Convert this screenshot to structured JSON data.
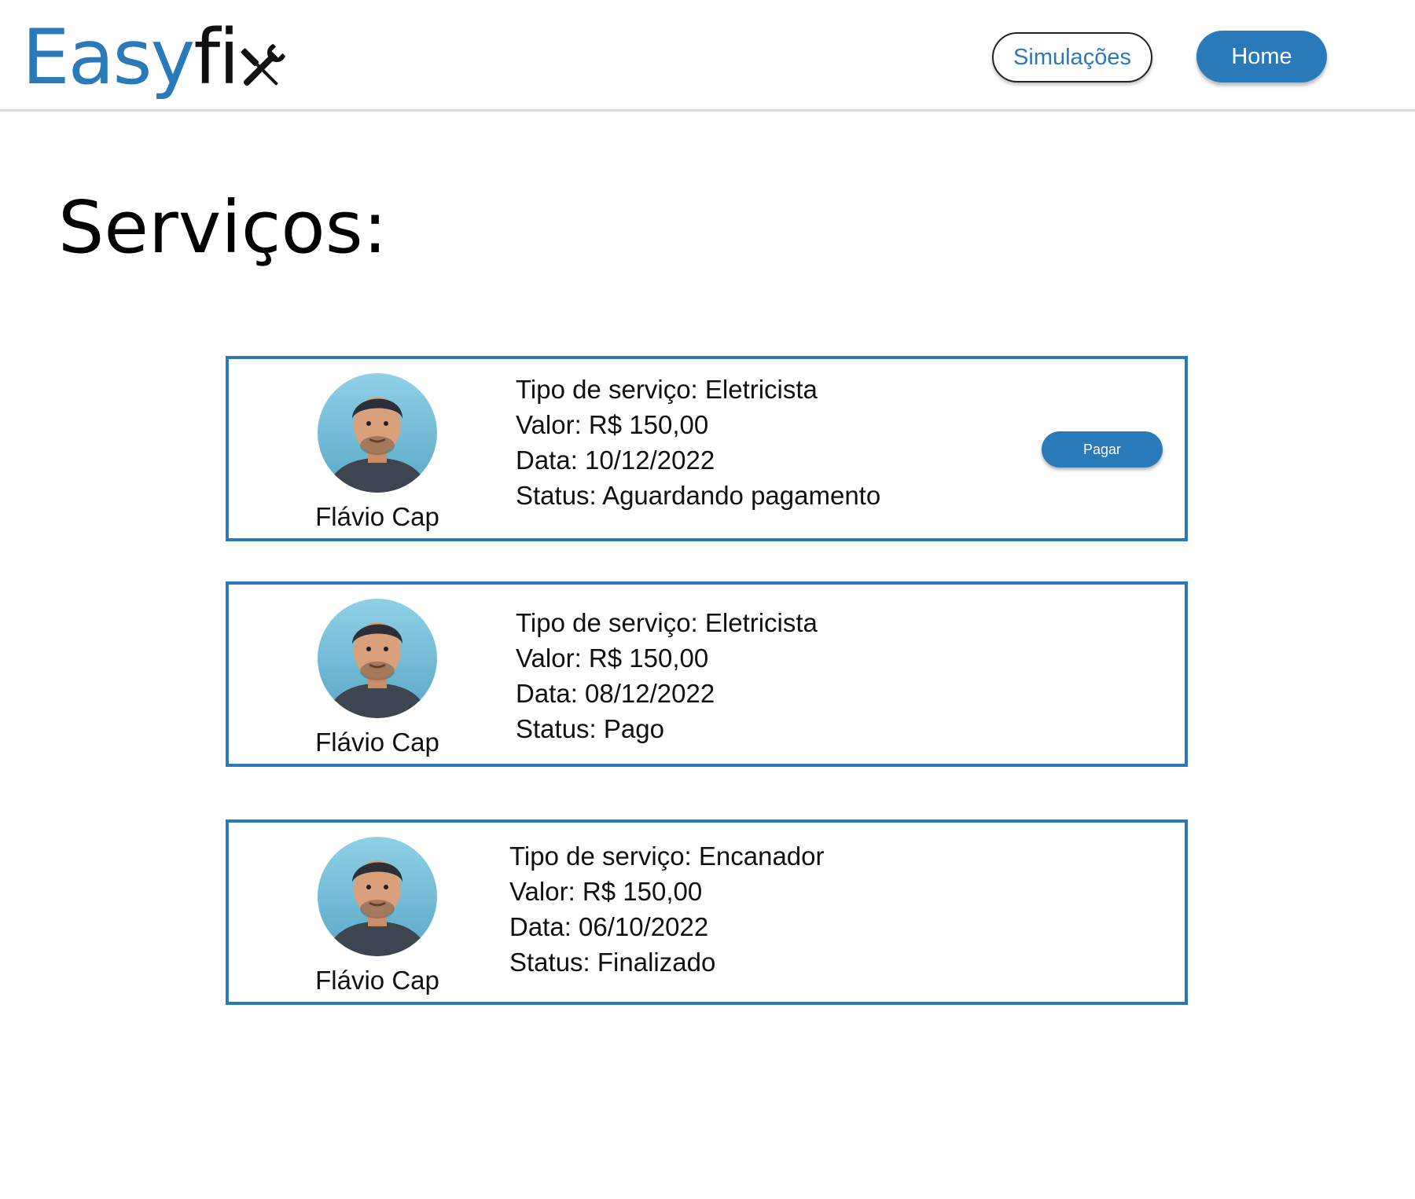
{
  "header": {
    "logo_easy": "Easy",
    "logo_fix": "fi",
    "nav_simulacoes": "Simulações",
    "nav_home": "Home"
  },
  "page": {
    "title": "Serviços:"
  },
  "services": [
    {
      "provider": "Flávio Cap",
      "tipo": "Tipo de serviço: Eletricista",
      "valor": "Valor: R$ 150,00",
      "data": "Data: 10/12/2022",
      "status": "Status: Aguardando pagamento",
      "pay_label": "Pagar"
    },
    {
      "provider": "Flávio Cap",
      "tipo": "Tipo de serviço: Eletricista",
      "valor": "Valor: R$ 150,00",
      "data": "Data: 08/12/2022",
      "status": "Status: Pago"
    },
    {
      "provider": "Flávio Cap",
      "tipo": "Tipo de serviço: Encanador",
      "valor": "Valor: R$ 150,00",
      "data": "Data: 06/10/2022",
      "status": "Status: Finalizado"
    }
  ],
  "icons": {
    "logo_tools": "wrench-screwdriver-icon",
    "avatar": "person-photo"
  },
  "colors": {
    "brand_blue": "#2a79b9",
    "text": "#111111"
  }
}
